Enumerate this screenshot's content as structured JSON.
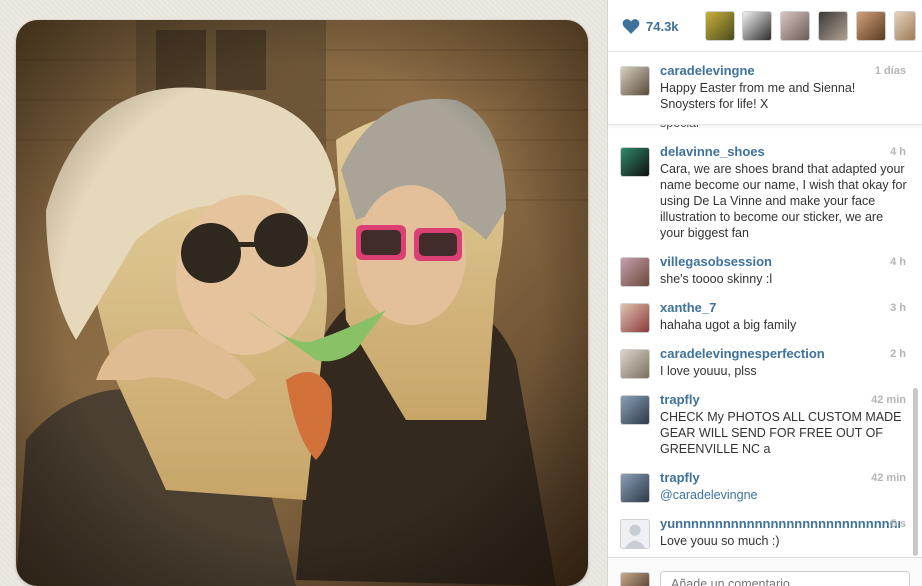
{
  "post": {
    "likes": "74.3k",
    "caption": {
      "username": "caradelevingne",
      "time": "1 días",
      "text": "Happy Easter from me and Sienna! Snoysters for life! X"
    },
    "cut_text": "special"
  },
  "comments": [
    {
      "username": "delavinne_shoes",
      "time": "4 h",
      "text": "Cara, we are shoes brand that adapted your name become our name, I wish that okay for using De La Vinne and make your face illustration to become our sticker, we are your biggest fan"
    },
    {
      "username": "villegasobsession",
      "time": "4 h",
      "text": "she's toooo skinny :l"
    },
    {
      "username": "xanthe_7",
      "time": "3 h",
      "text": "hahaha ugot a big family"
    },
    {
      "username": "caradelevingnesperfection",
      "time": "2 h",
      "text": "I love youuu, plss"
    },
    {
      "username": "trapfly",
      "time": "42 min",
      "text": "CHECK My PHOTOS ALL CUSTOM MADE GEAR WILL SEND FOR FREE OUT OF GREENVILLE NC a"
    },
    {
      "username": "trapfly",
      "time": "42 min",
      "text": "@caradelevingne"
    },
    {
      "username": "yunnnnnnnnnnnnnnnnnnnnnnnnnnnnny",
      "time": "5 s",
      "text": "Love youu so much :)"
    }
  ],
  "comment_input": {
    "placeholder": "Añade un comentario..."
  },
  "colors": {
    "link": "#3f729b",
    "time": "#b4b4b4",
    "heart": "#3f729b"
  },
  "icons": [
    "heart-icon"
  ]
}
